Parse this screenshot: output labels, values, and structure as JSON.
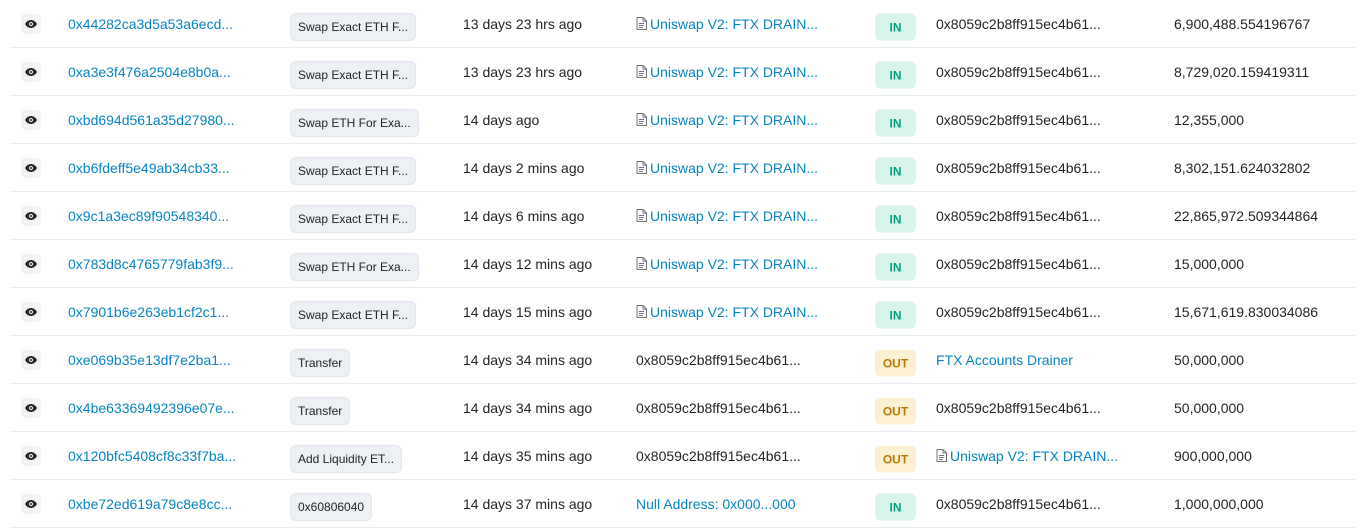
{
  "colors": {
    "link": "#0784c3",
    "in_bg": "#daf5ec",
    "in_text": "#00a186",
    "out_bg": "#fbf0d2",
    "out_text": "#b47d00"
  },
  "rows": [
    {
      "hash": "0x44282ca3d5a53a6ecd...",
      "method": "Swap Exact ETH F...",
      "age": "13 days 23 hrs ago",
      "from": {
        "text": "Uniswap V2: FTX DRAIN...",
        "link": true,
        "contract": true
      },
      "direction": "IN",
      "to": {
        "text": "0x8059c2b8ff915ec4b61...",
        "link": false,
        "contract": false
      },
      "quantity": "6,900,488.554196767"
    },
    {
      "hash": "0xa3e3f476a2504e8b0a...",
      "method": "Swap Exact ETH F...",
      "age": "13 days 23 hrs ago",
      "from": {
        "text": "Uniswap V2: FTX DRAIN...",
        "link": true,
        "contract": true
      },
      "direction": "IN",
      "to": {
        "text": "0x8059c2b8ff915ec4b61...",
        "link": false,
        "contract": false
      },
      "quantity": "8,729,020.159419311"
    },
    {
      "hash": "0xbd694d561a35d27980...",
      "method": "Swap ETH For Exa...",
      "age": "14 days ago",
      "from": {
        "text": "Uniswap V2: FTX DRAIN...",
        "link": true,
        "contract": true
      },
      "direction": "IN",
      "to": {
        "text": "0x8059c2b8ff915ec4b61...",
        "link": false,
        "contract": false
      },
      "quantity": "12,355,000"
    },
    {
      "hash": "0xb6fdeff5e49ab34cb33...",
      "method": "Swap Exact ETH F...",
      "age": "14 days 2 mins ago",
      "from": {
        "text": "Uniswap V2: FTX DRAIN...",
        "link": true,
        "contract": true
      },
      "direction": "IN",
      "to": {
        "text": "0x8059c2b8ff915ec4b61...",
        "link": false,
        "contract": false
      },
      "quantity": "8,302,151.624032802"
    },
    {
      "hash": "0x9c1a3ec89f90548340...",
      "method": "Swap Exact ETH F...",
      "age": "14 days 6 mins ago",
      "from": {
        "text": "Uniswap V2: FTX DRAIN...",
        "link": true,
        "contract": true
      },
      "direction": "IN",
      "to": {
        "text": "0x8059c2b8ff915ec4b61...",
        "link": false,
        "contract": false
      },
      "quantity": "22,865,972.509344864"
    },
    {
      "hash": "0x783d8c4765779fab3f9...",
      "method": "Swap ETH For Exa...",
      "age": "14 days 12 mins ago",
      "from": {
        "text": "Uniswap V2: FTX DRAIN...",
        "link": true,
        "contract": true
      },
      "direction": "IN",
      "to": {
        "text": "0x8059c2b8ff915ec4b61...",
        "link": false,
        "contract": false
      },
      "quantity": "15,000,000"
    },
    {
      "hash": "0x7901b6e263eb1cf2c1...",
      "method": "Swap Exact ETH F...",
      "age": "14 days 15 mins ago",
      "from": {
        "text": "Uniswap V2: FTX DRAIN...",
        "link": true,
        "contract": true
      },
      "direction": "IN",
      "to": {
        "text": "0x8059c2b8ff915ec4b61...",
        "link": false,
        "contract": false
      },
      "quantity": "15,671,619.830034086"
    },
    {
      "hash": "0xe069b35e13df7e2ba1...",
      "method": "Transfer",
      "age": "14 days 34 mins ago",
      "from": {
        "text": "0x8059c2b8ff915ec4b61...",
        "link": false,
        "contract": false
      },
      "direction": "OUT",
      "to": {
        "text": "FTX Accounts Drainer",
        "link": true,
        "contract": false
      },
      "quantity": "50,000,000"
    },
    {
      "hash": "0x4be63369492396e07e...",
      "method": "Transfer",
      "age": "14 days 34 mins ago",
      "from": {
        "text": "0x8059c2b8ff915ec4b61...",
        "link": false,
        "contract": false
      },
      "direction": "OUT",
      "to": {
        "text": "0x8059c2b8ff915ec4b61...",
        "link": false,
        "contract": false
      },
      "quantity": "50,000,000"
    },
    {
      "hash": "0x120bfc5408cf8c33f7ba...",
      "method": "Add Liquidity ET...",
      "age": "14 days 35 mins ago",
      "from": {
        "text": "0x8059c2b8ff915ec4b61...",
        "link": false,
        "contract": false
      },
      "direction": "OUT",
      "to": {
        "text": "Uniswap V2: FTX DRAIN...",
        "link": true,
        "contract": true
      },
      "quantity": "900,000,000"
    },
    {
      "hash": "0xbe72ed619a79c8e8cc...",
      "method": "0x60806040",
      "age": "14 days 37 mins ago",
      "from": {
        "text": "Null Address: 0x000...000",
        "link": true,
        "contract": false
      },
      "direction": "IN",
      "to": {
        "text": "0x8059c2b8ff915ec4b61...",
        "link": false,
        "contract": false
      },
      "quantity": "1,000,000,000"
    }
  ]
}
